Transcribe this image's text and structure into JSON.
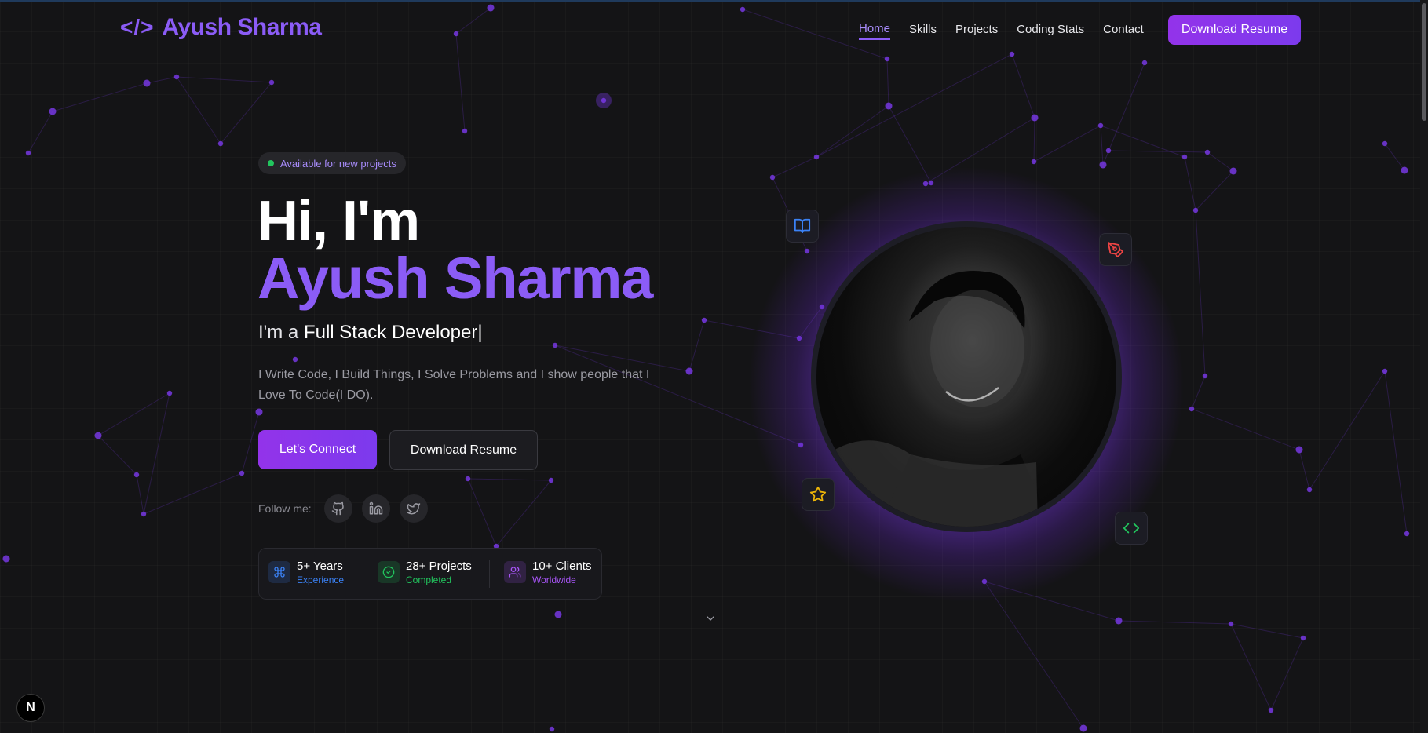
{
  "brand": {
    "code_glyph": "</>",
    "name": "Ayush Sharma",
    "accent": "#8b5cf6"
  },
  "nav": {
    "items": [
      {
        "label": "Home",
        "active": true
      },
      {
        "label": "Skills",
        "active": false
      },
      {
        "label": "Projects",
        "active": false
      },
      {
        "label": "Coding Stats",
        "active": false
      },
      {
        "label": "Contact",
        "active": false
      }
    ],
    "cta_label": "Download Resume"
  },
  "hero": {
    "badge": "Available for new projects",
    "greeting": "Hi, I'm",
    "name": "Ayush Sharma",
    "role_prefix": "I'm a ",
    "role": "Full Stack Developer|",
    "description": "I Write Code, I Build Things, I Solve Problems and I show people that I Love To Code(I DO).",
    "primary_cta": "Let's Connect",
    "secondary_cta": "Download Resume",
    "follow_label": "Follow me:",
    "socials": [
      "github-icon",
      "linkedin-icon",
      "twitter-icon"
    ]
  },
  "stats": [
    {
      "value": "5+ Years",
      "label": "Experience",
      "icon": "command-icon",
      "color": "#3b82f6"
    },
    {
      "value": "28+ Projects",
      "label": "Completed",
      "icon": "check-circle-icon",
      "color": "#22c55e"
    },
    {
      "value": "10+ Clients",
      "label": "Worldwide",
      "icon": "users-icon",
      "color": "#a855f7"
    }
  ],
  "profile": {
    "floating_icons": [
      "book-icon",
      "pen-tool-icon",
      "star-icon",
      "code-icon"
    ]
  },
  "dev_badge": "N"
}
